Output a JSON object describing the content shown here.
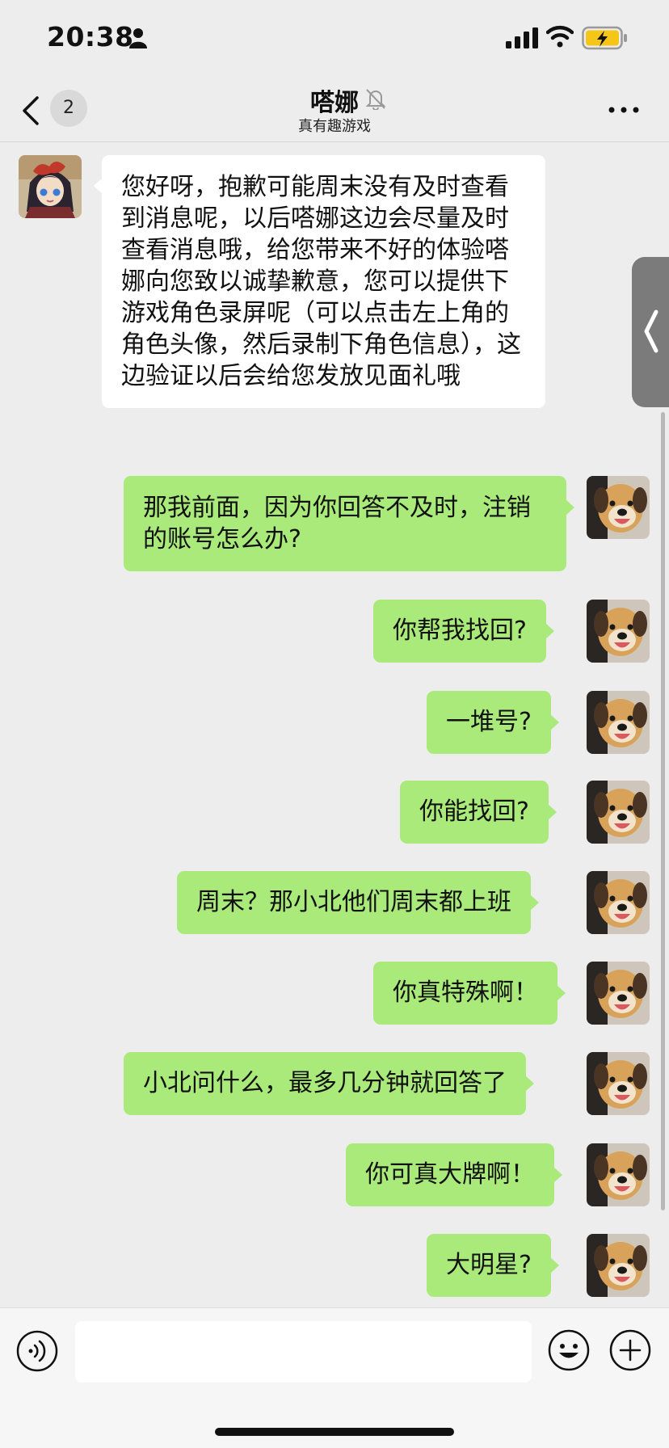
{
  "status_bar": {
    "time": "20:38",
    "person_icon": "person-icon",
    "signal_icon": "cellular-signal-icon",
    "wifi_icon": "wifi-icon",
    "battery_icon": "battery-charging-icon",
    "battery_color": "#f5c518"
  },
  "nav": {
    "back_icon": "chevron-left-icon",
    "unread_count": "2",
    "title": "嗒娜",
    "mute_icon": "bell-muted-icon",
    "subtitle": "真有趣游戏",
    "more_icon": "more-dots-icon"
  },
  "colors": {
    "background": "#ededed",
    "incoming_bubble": "#ffffff",
    "outgoing_bubble": "#a9ea7a"
  },
  "messages": [
    {
      "from": "contact",
      "avatar": "anime-girl-avatar",
      "text": "您好呀，抱歉可能周末没有及时查看到消息呢，以后嗒娜这边会尽量及时查看消息哦，给您带来不好的体验嗒娜向您致以诚挚歉意，您可以提供下游戏角色录屏呢（可以点击左上角的角色头像，然后录制下角色信息），这边验证以后会给您发放见面礼哦"
    },
    {
      "from": "me",
      "avatar": "dog-avatar",
      "text": "那我前面，因为你回答不及时，注销的账号怎么办?"
    },
    {
      "from": "me",
      "avatar": "dog-avatar",
      "text": "你帮我找回?"
    },
    {
      "from": "me",
      "avatar": "dog-avatar",
      "text": "一堆号?"
    },
    {
      "from": "me",
      "avatar": "dog-avatar",
      "text": "你能找回?"
    },
    {
      "from": "me",
      "avatar": "dog-avatar",
      "text": "周末？那小北他们周末都上班"
    },
    {
      "from": "me",
      "avatar": "dog-avatar",
      "text": "你真特殊啊！"
    },
    {
      "from": "me",
      "avatar": "dog-avatar",
      "text": "小北问什么，最多几分钟就回答了"
    },
    {
      "from": "me",
      "avatar": "dog-avatar",
      "text": "你可真大牌啊！"
    },
    {
      "from": "me",
      "avatar": "dog-avatar",
      "text": "大明星?"
    }
  ],
  "side_tab_icon": "chevron-left-icon",
  "input_bar": {
    "voice_icon": "voice-icon",
    "text_value": "",
    "emoji_icon": "emoji-icon",
    "plus_icon": "plus-icon"
  }
}
